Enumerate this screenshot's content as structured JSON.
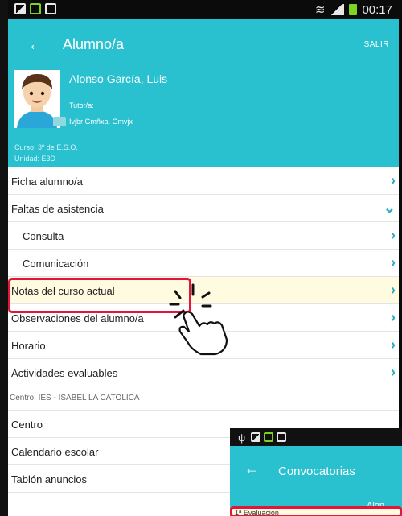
{
  "status_bar": {
    "time": "00:17"
  },
  "app_bar": {
    "back_icon": "arrow-left-icon",
    "title": "Alumno/a",
    "exit_label": "SALIR"
  },
  "student": {
    "name": "Alonso García, Luis",
    "tutor_label": "Tutor/a:",
    "tutor_name": "Ivjbr Gmñxa, Gmvjx",
    "course": "Curso:  3º de E.S.O.",
    "unit": "Unidad:  E3D"
  },
  "menu": {
    "ficha": "Ficha alumno/a",
    "faltas": "Faltas de asistencia",
    "consulta": "Consulta",
    "comunicacion": "Comunicación",
    "notas": "Notas del curso actual",
    "observaciones": "Observaciones del alumno/a",
    "horario": "Horario",
    "actividades": "Actividades evaluables",
    "centro_label": "Centro: IES - ISABEL LA CATOLICA",
    "centro": "Centro",
    "calendario": "Calendario escolar",
    "tablon": "Tablón anuncios"
  },
  "icons": {
    "chevron_right": "›",
    "chevron_down": "⌄"
  },
  "inset": {
    "title": "Convocatorias",
    "student_short": "Alon",
    "evaluation": "1ª Evaluación"
  },
  "colors": {
    "accent": "#29c1cf",
    "chevron": "#2aa9c4",
    "highlight": "#e4143a"
  }
}
